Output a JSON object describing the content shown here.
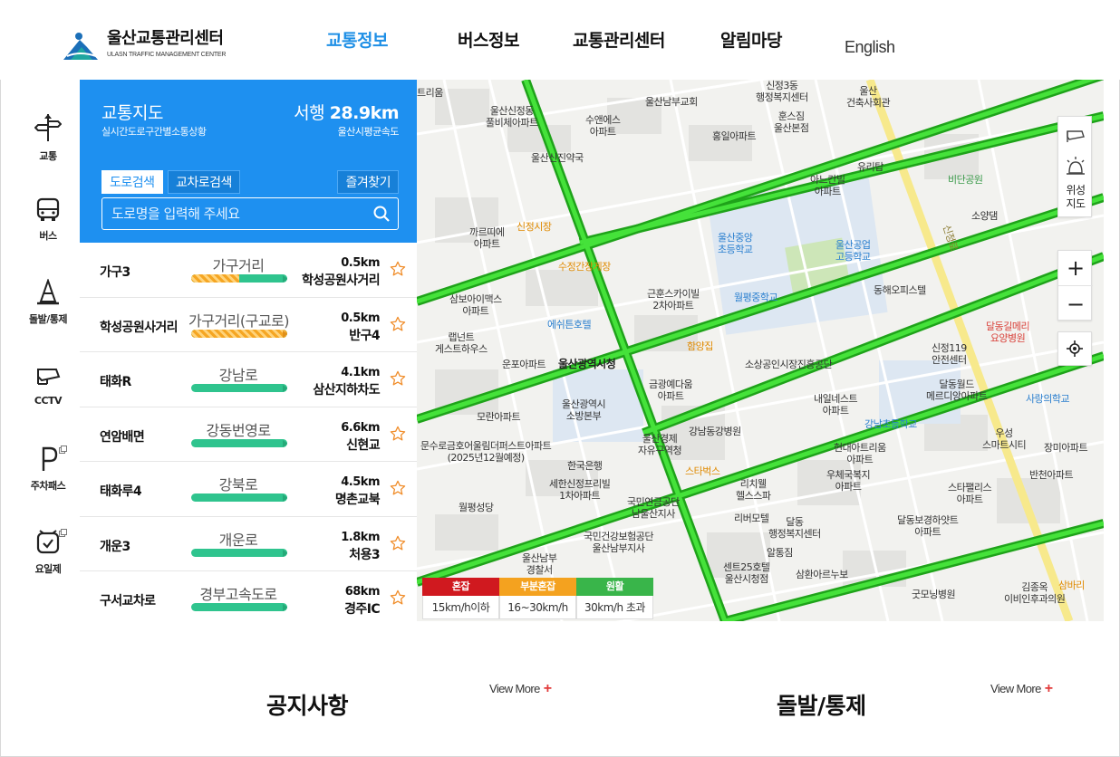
{
  "header": {
    "logo_ko": "울산교통관리센터",
    "logo_en": "ULASN TRAFFIC MANAGEMENT CENTER",
    "nav": [
      "교통정보",
      "버스정보",
      "교통관리센터",
      "알림마당"
    ],
    "active_nav": "교통정보",
    "lang": "English"
  },
  "rail": [
    {
      "label": "교통",
      "icon": "traffic-signpost-icon"
    },
    {
      "label": "버스",
      "icon": "bus-icon"
    },
    {
      "label": "돌발/통제",
      "icon": "traffic-cone-icon"
    },
    {
      "label": "CCTV",
      "icon": "cctv-camera-icon"
    },
    {
      "label": "주차패스",
      "icon": "parking-icon"
    },
    {
      "label": "요일제",
      "icon": "alarm-clock-icon"
    }
  ],
  "panel": {
    "title": "교통지도",
    "subtitle": "실시간도로구간별소통상황",
    "direction": "서행",
    "distance": "28.9km",
    "place": "울산시평균속도",
    "tab_road": "도로검색",
    "tab_intersection": "교차로검색",
    "favorites": "즐겨찾기",
    "search_placeholder": "도로명을 입력해 주세요"
  },
  "roads": [
    {
      "from": "가구3",
      "road": "가구거리",
      "dist": "0.5km",
      "to": "학성공원사거리",
      "slow": 0.5
    },
    {
      "from": "학성공원사거리",
      "road": "가구거리(구교로)",
      "dist": "0.5km",
      "to": "반구4",
      "slow": 1.0
    },
    {
      "from": "태화R",
      "road": "강남로",
      "dist": "4.1km",
      "to": "삼산지하차도",
      "slow": 0
    },
    {
      "from": "연암배면",
      "road": "강동번영로",
      "dist": "6.6km",
      "to": "신현교",
      "slow": 0
    },
    {
      "from": "태화루4",
      "road": "강북로",
      "dist": "4.5km",
      "to": "명촌교북",
      "slow": 0
    },
    {
      "from": "개운3",
      "road": "개운로",
      "dist": "1.8km",
      "to": "처용3",
      "slow": 0
    },
    {
      "from": "구서교차로",
      "road": "경부고속도로",
      "dist": "68km",
      "to": "경주IC",
      "slow": 0
    }
  ],
  "map": {
    "labels": [
      {
        "t": "트리움",
        "c": ""
      },
      {
        "t": "울산신정동\n풀비체아파트",
        "c": ""
      },
      {
        "t": "울산남부교회",
        "c": ""
      },
      {
        "t": "신정3동\n행정복지센터",
        "c": ""
      },
      {
        "t": "울산\n건축사회관",
        "c": ""
      },
      {
        "t": "수앤에스\n아파트",
        "c": ""
      },
      {
        "t": "훈스짐\n울산본점",
        "c": ""
      },
      {
        "t": "홍일아파트",
        "c": ""
      },
      {
        "t": "울산신진약국",
        "c": ""
      },
      {
        "t": "아느칸빌\n아파트",
        "c": ""
      },
      {
        "t": "유리탑",
        "c": ""
      },
      {
        "t": "비단공원",
        "c": "green"
      },
      {
        "t": "신정시장",
        "c": "orange"
      },
      {
        "t": "까르띠에\n아파트",
        "c": ""
      },
      {
        "t": "소양댐",
        "c": ""
      },
      {
        "t": "울산중앙\n초등학교",
        "c": "blue"
      },
      {
        "t": "울산공업\n고등학교",
        "c": "blue"
      },
      {
        "t": "수정간장게장",
        "c": "orange"
      },
      {
        "t": "삼보아이맥스\n아파트",
        "c": ""
      },
      {
        "t": "근훈스카이빌\n2차아파트",
        "c": ""
      },
      {
        "t": "월평중학교",
        "c": "blue"
      },
      {
        "t": "동해오피스텔",
        "c": ""
      },
      {
        "t": "에쉬튼호텔",
        "c": "blue"
      },
      {
        "t": "랩넌트\n게스트하우스",
        "c": ""
      },
      {
        "t": "함양집",
        "c": "orange"
      },
      {
        "t": "달동길메리\n요양병원",
        "c": "red"
      },
      {
        "t": "운포아파트",
        "c": ""
      },
      {
        "t": "울산광역시청",
        "c": "big"
      },
      {
        "t": "소상공인시장진흥공단",
        "c": ""
      },
      {
        "t": "신정119\n안전센터",
        "c": ""
      },
      {
        "t": "금광예다움\n아파트",
        "c": ""
      },
      {
        "t": "달동월드\n메르디앙아파트",
        "c": ""
      },
      {
        "t": "울산광역시\n소방본부",
        "c": ""
      },
      {
        "t": "내일네스트\n아파트",
        "c": ""
      },
      {
        "t": "사랑의학교",
        "c": "blue"
      },
      {
        "t": "모란아파트",
        "c": ""
      },
      {
        "t": "강남동강병원",
        "c": ""
      },
      {
        "t": "강남초등학교",
        "c": "blue"
      },
      {
        "t": "문수로금호어울림더퍼스트아파트\n(2025년12월예정)",
        "c": ""
      },
      {
        "t": "울산경제\n자유구역청",
        "c": ""
      },
      {
        "t": "우성\n스마트시티",
        "c": ""
      },
      {
        "t": "현대아트리움\n아파트",
        "c": ""
      },
      {
        "t": "장미아파트",
        "c": ""
      },
      {
        "t": "한국은행",
        "c": ""
      },
      {
        "t": "스타벅스",
        "c": "orange"
      },
      {
        "t": "우체국복지\n아파트",
        "c": ""
      },
      {
        "t": "세한신정프리빌\n1차아파트",
        "c": ""
      },
      {
        "t": "리치웰\n헬스스파",
        "c": ""
      },
      {
        "t": "반천아파트",
        "c": ""
      },
      {
        "t": "스타팰리스\n아파트",
        "c": ""
      },
      {
        "t": "월평성당",
        "c": ""
      },
      {
        "t": "국민연금공단\n남울산지사",
        "c": ""
      },
      {
        "t": "리버모텔",
        "c": ""
      },
      {
        "t": "달동\n행정복지센터",
        "c": ""
      },
      {
        "t": "달동보경하얏트\n아파트",
        "c": ""
      },
      {
        "t": "국민건강보험공단\n울산남부지사",
        "c": ""
      },
      {
        "t": "알통짐",
        "c": ""
      },
      {
        "t": "울산남부\n경찰서",
        "c": ""
      },
      {
        "t": "센트25호텔\n울산시청점",
        "c": ""
      },
      {
        "t": "삼환아르누보",
        "c": ""
      },
      {
        "t": "김종옥\n이비인후과의원",
        "c": ""
      },
      {
        "t": "굿모닝병원",
        "c": ""
      },
      {
        "t": "삼바리",
        "c": "orange"
      }
    ],
    "road_name": "신정로",
    "satellite_label": "위성\n지도",
    "zoom_in": "+",
    "zoom_out": "−",
    "legend": [
      {
        "head": "혼잡",
        "val": "15km/h이하",
        "color": "#d0191f"
      },
      {
        "head": "부분혼잡",
        "val": "16~30km/h",
        "color": "#f4a21f"
      },
      {
        "head": "원활",
        "val": "30km/h 초과",
        "color": "#39b54a"
      }
    ]
  },
  "bottom": {
    "notice_title": "공지사항",
    "incident_title": "돌발/통제",
    "view_more": "View More",
    "plus": "+"
  },
  "colors": {
    "accent": "#1e90f0",
    "active_nav": "#1e8fe6",
    "smooth": "#2fc48e",
    "road_green": "#22d31c"
  }
}
